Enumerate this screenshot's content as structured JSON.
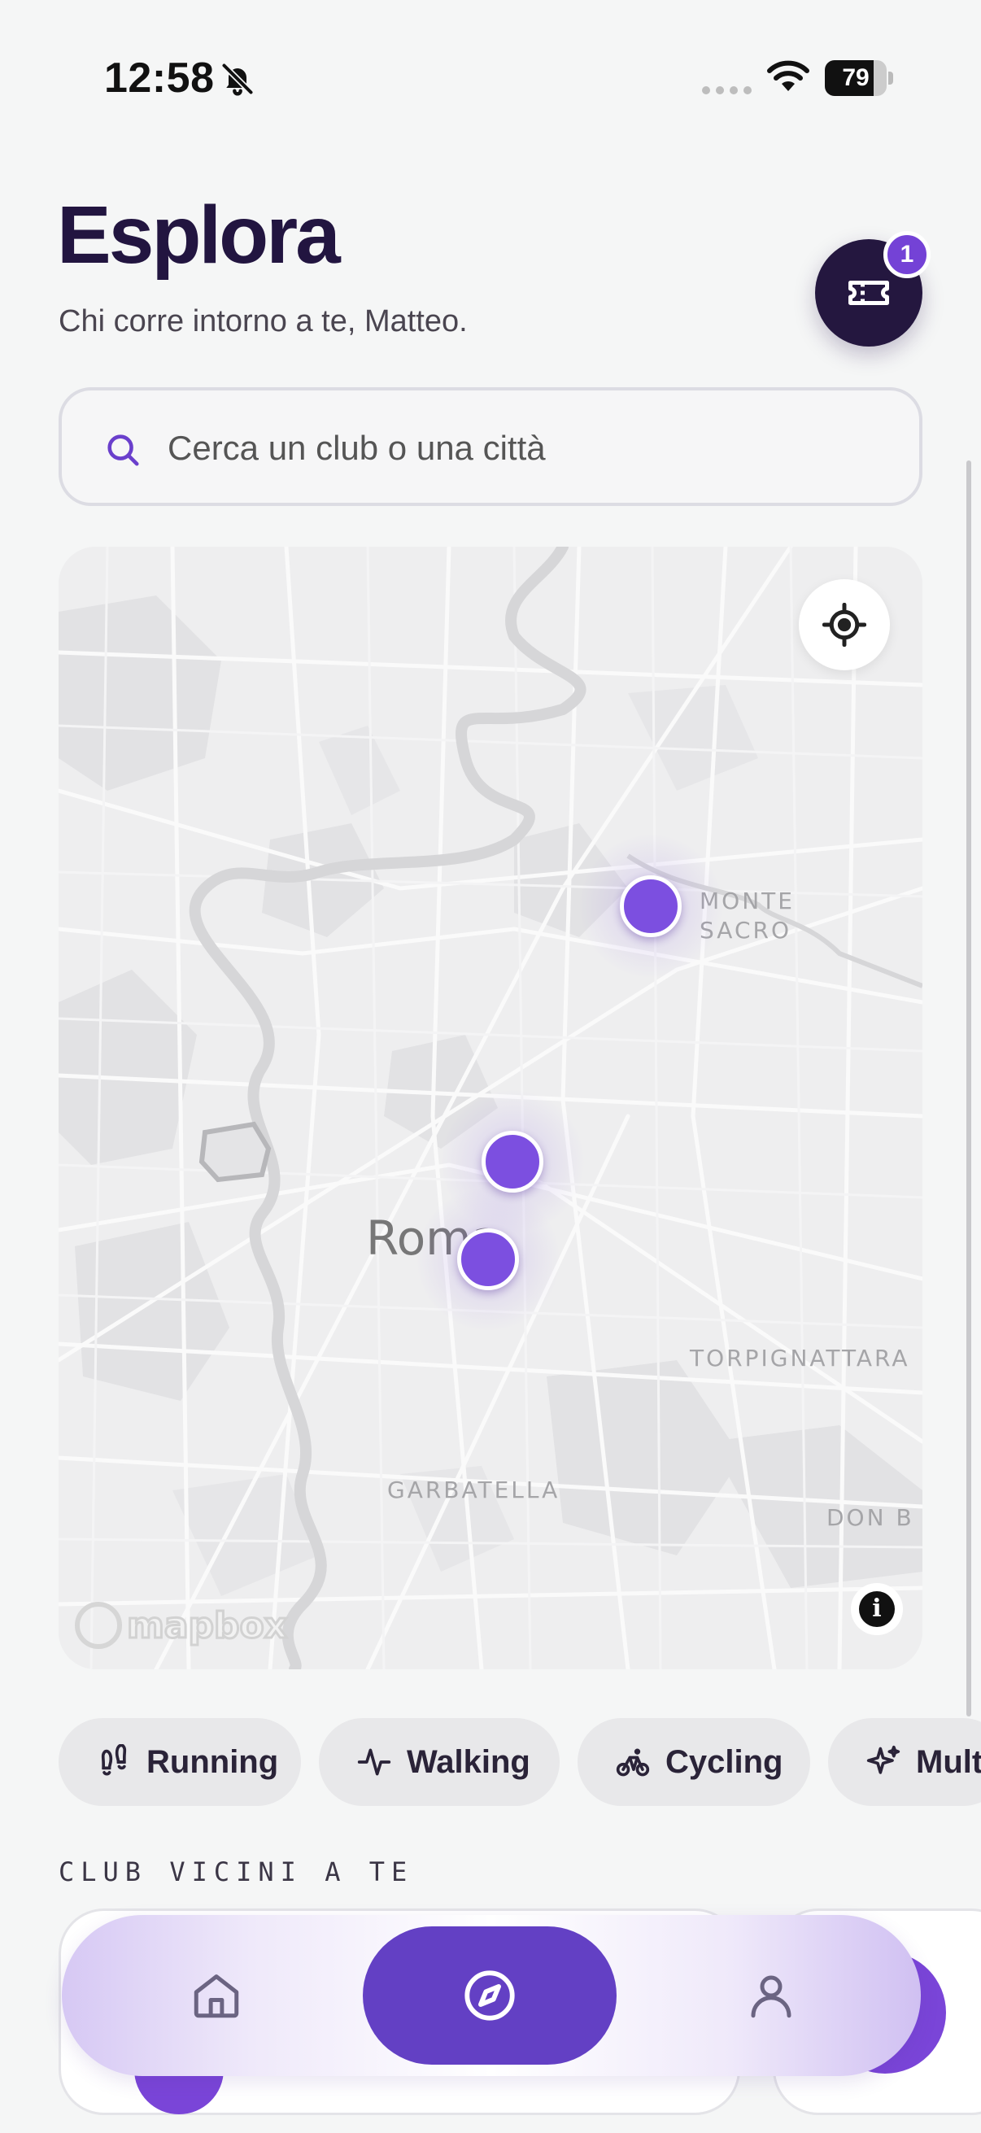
{
  "status_bar": {
    "time": "12:58",
    "battery": "79",
    "battery_level": 0.79
  },
  "header": {
    "title": "Esplora",
    "subtitle": "Chi corre intorno a te, Matteo.",
    "ticket_badge": "1"
  },
  "search": {
    "placeholder": "Cerca un club o una città"
  },
  "map": {
    "city": "Roma",
    "labels": {
      "monte_sacro": "MONTE\nSACRO",
      "torpignattara": "TORPIGNATTARA",
      "garbatella": "GARBATELLA",
      "don_bosco": "DON B"
    },
    "attribution": "mapbox",
    "info": "i"
  },
  "filters": [
    {
      "label": "Running",
      "icon": "footprints-icon"
    },
    {
      "label": "Walking",
      "icon": "activity-pulse-icon"
    },
    {
      "label": "Cycling",
      "icon": "bicycle-icon"
    },
    {
      "label": "Multi",
      "icon": "sparkles-icon"
    }
  ],
  "section": {
    "title": "CLUB VICINI A TE"
  },
  "tabbar": {
    "items": [
      {
        "name": "home",
        "icon": "home-icon"
      },
      {
        "name": "explore",
        "icon": "compass-icon",
        "active": true
      },
      {
        "name": "profile",
        "icon": "user-icon"
      }
    ]
  },
  "colors": {
    "accent": "#6340c4",
    "marker": "#7c4fe0",
    "title": "#221540",
    "dark_button": "#24173f"
  }
}
